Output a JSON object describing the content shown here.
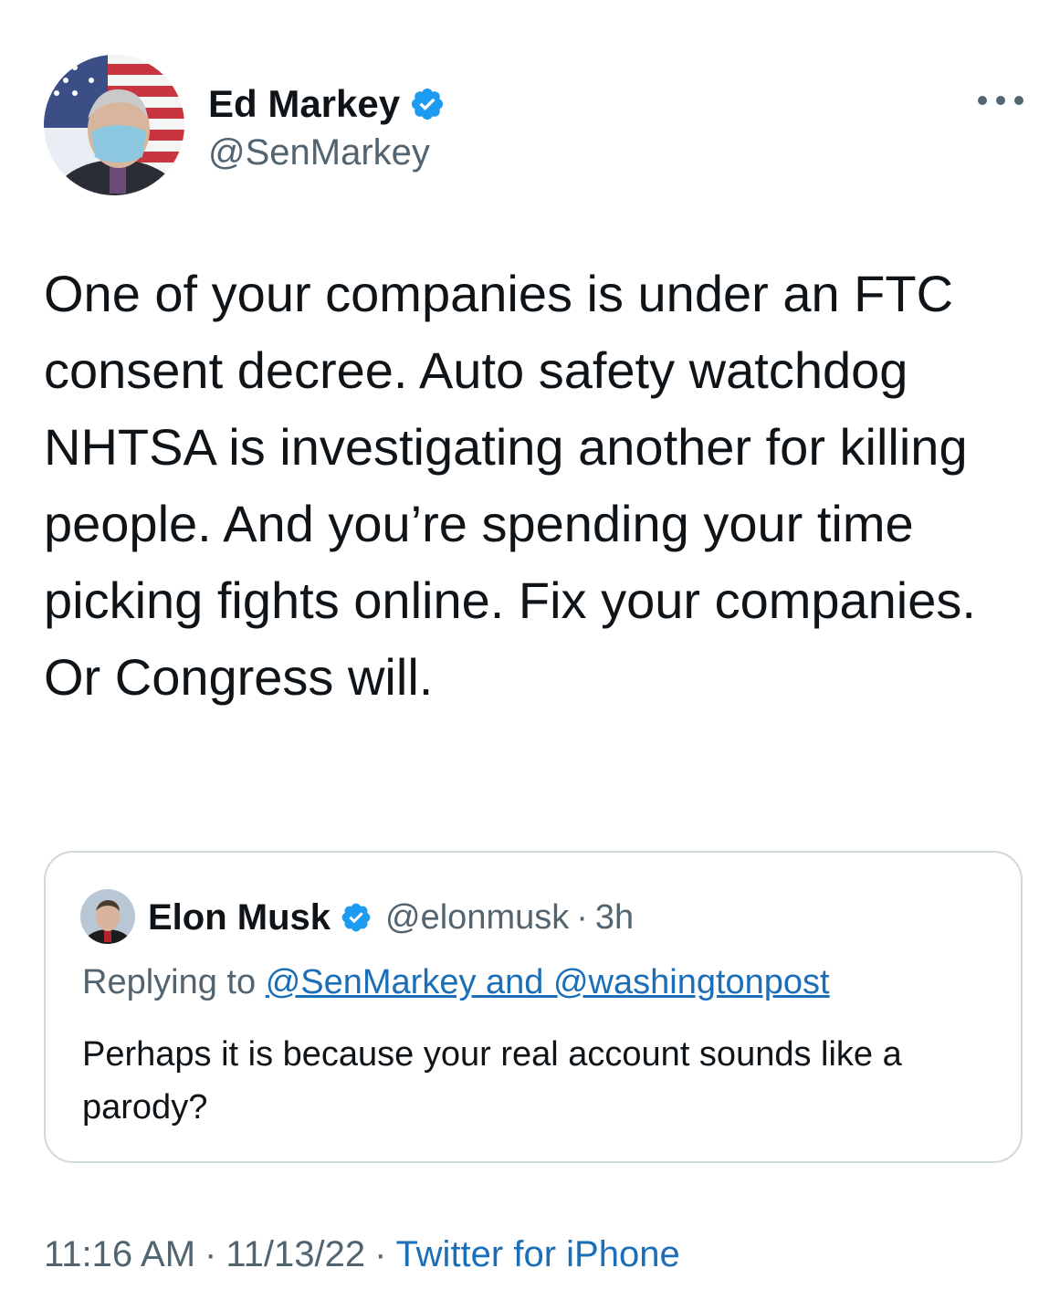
{
  "tweet": {
    "author": {
      "name": "Ed Markey",
      "handle": "@SenMarkey",
      "verified": true
    },
    "text": "One of your companies is under an FTC consent decree. Auto safety watchdog NHTSA is investigating another for killing people. And you’re spending your time picking fights online. Fix your companies. Or Congress will.",
    "quoted": {
      "author_name": "Elon Musk",
      "handle": "@elonmusk",
      "separator": "·",
      "time": "3h",
      "replying_prefix": "Replying to",
      "replying_to": "@SenMarkey and @washingtonpost",
      "text": "Perhaps it is because your real account sounds like a parody?"
    },
    "meta": {
      "time": "11:16 AM",
      "date": "11/13/22",
      "source": "Twitter for iPhone",
      "separator": "·"
    }
  },
  "icons": {
    "verified": "verified-badge-icon",
    "more": "more-horizontal-icon"
  },
  "colors": {
    "accent": "#1d9bf0",
    "link": "#1a6fb8",
    "text": "#0f1419",
    "secondary": "#536471",
    "border": "#cfd9de"
  }
}
